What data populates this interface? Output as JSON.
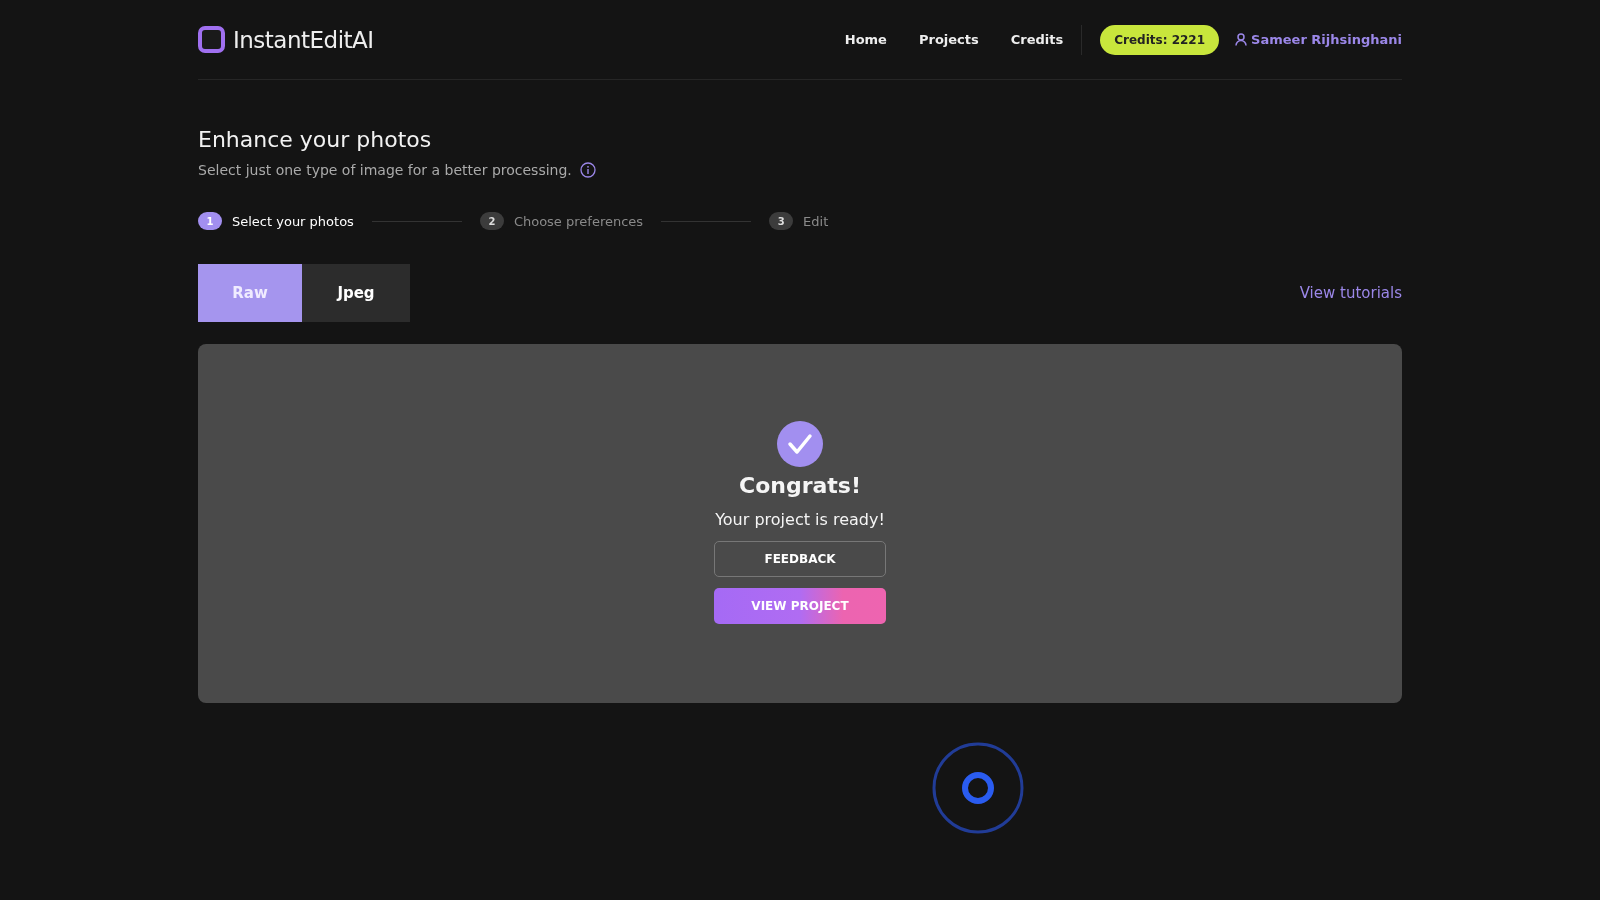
{
  "header": {
    "logo": "InstantEditAI",
    "nav": [
      "Home",
      "Projects",
      "Credits"
    ],
    "credits_badge": "Credits: 2221",
    "user": "Sameer Rijhsinghani"
  },
  "page": {
    "title": "Enhance your photos",
    "subtitle": "Select just one type of image for a better processing."
  },
  "steps": [
    {
      "number": "1",
      "label": "Select your photos",
      "active": true
    },
    {
      "number": "2",
      "label": "Choose preferences",
      "active": false
    },
    {
      "number": "3",
      "label": "Edit",
      "active": false
    }
  ],
  "tabs": [
    {
      "label": "Raw",
      "selected": true
    },
    {
      "label": "Jpeg",
      "selected": false
    }
  ],
  "tutorials_link": "View tutorials",
  "result": {
    "heading": "Congrats!",
    "message": "Your project is ready!",
    "buttons": [
      {
        "label": "FEEDBACK",
        "kind": "outline"
      },
      {
        "label": "VIEW PROJECT",
        "kind": "gradient"
      }
    ]
  }
}
